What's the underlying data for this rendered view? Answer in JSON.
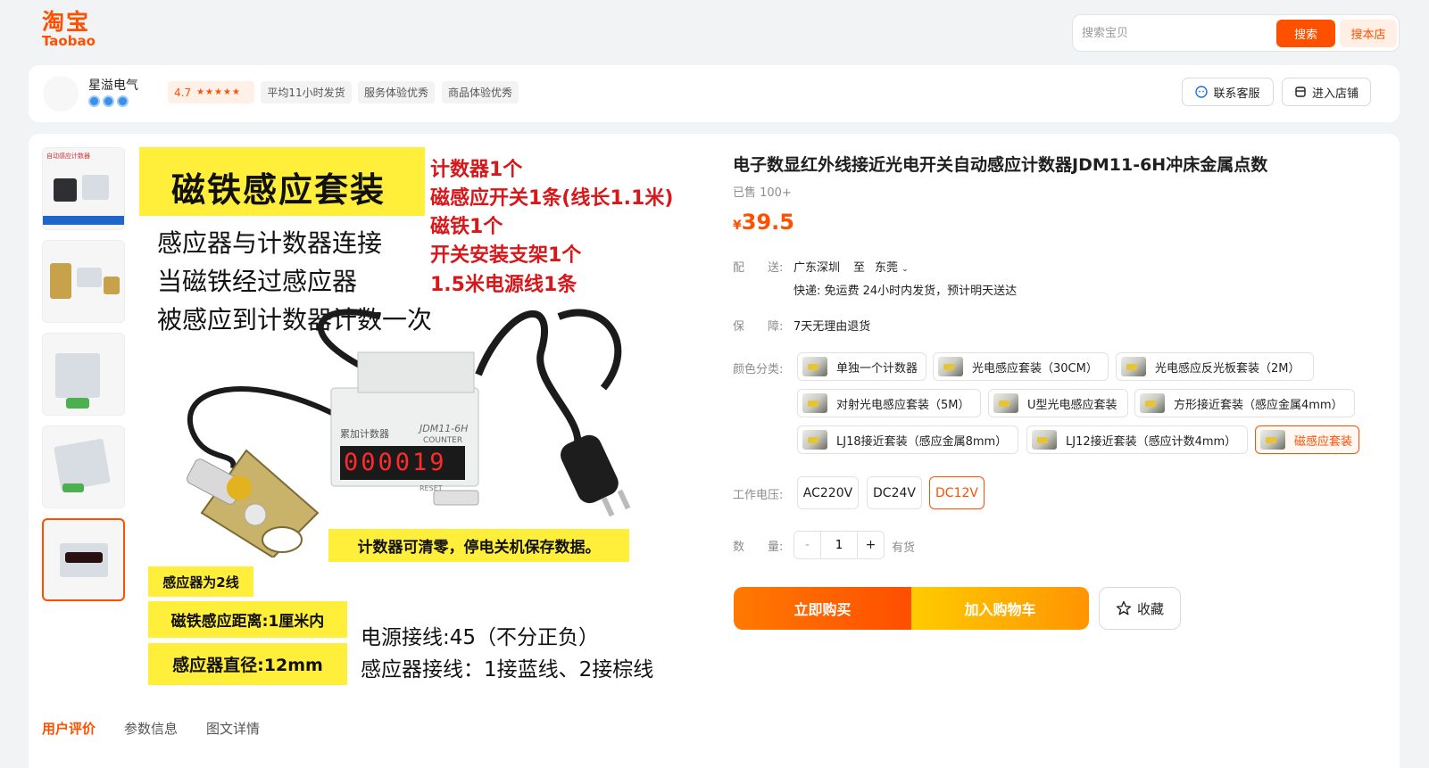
{
  "header": {
    "logo_cn": "淘宝",
    "logo_en": "Taobao",
    "search_placeholder": "搜索宝贝",
    "search_button": "搜索",
    "store_search_button": "搜本店"
  },
  "shop": {
    "name": "星溢电气",
    "rating": "4.7",
    "stars": "★★★★★",
    "tags": [
      "平均11小时发货",
      "服务体验优秀",
      "商品体验优秀"
    ],
    "contact_button": "联系客服",
    "enter_store_button": "进入店铺"
  },
  "gallery": {
    "image_text": {
      "title": "磁铁感应套装",
      "lines": [
        "感应器与计数器连接",
        "当磁铁经过感应器",
        "被感应到计数器计数一次"
      ],
      "contents": [
        "计数器1个",
        "磁感应开关1条(线长1.1米)",
        "磁铁1个",
        "开关安装支架1个",
        "1.5米电源线1条"
      ],
      "counter_label": "累加计数器",
      "counter_model": "JDM11-6H",
      "counter_sub": "COUNTER",
      "counter_display": "000019",
      "counter_reset": "RESET",
      "banner": "计数器可清零，停电关机保存数据。",
      "note1": "感应器为2线",
      "note2": "磁铁感应距离:1厘米内",
      "note3": "感应器直径:12mm",
      "wiring1": "电源接线:45（不分正负）",
      "wiring2": "感应器接线：1接蓝线、2接棕线"
    },
    "thumb1_title": "自动感应计数器"
  },
  "product": {
    "title": "电子数显红外线接近光电开关自动感应计数器JDM11-6H冲床金属点数",
    "sold": "已售 100+",
    "currency": "¥",
    "price": "39.5",
    "delivery_label": "配　　送:",
    "ship_from": "广东深圳",
    "ship_to_word": "至",
    "ship_to": "东莞",
    "delivery_detail": "快递: 免运费  24小时内发货，预计明天送达",
    "guarantee_label": "保　　障:",
    "guarantee": "7天无理由退货",
    "color_label": "颜色分类:",
    "colors": [
      "单独一个计数器",
      "光电感应套装（30CM）",
      "光电感应反光板套装（2M）",
      "对射光电感应套装（5M）",
      "U型光电感应套装",
      "方形接近套装（感应金属4mm）",
      "LJ18接近套装（感应金属8mm）",
      "LJ12接近套装（感应计数4mm）",
      "磁感应套装"
    ],
    "selected_color": "磁感应套装",
    "voltage_label": "工作电压:",
    "voltages": [
      "AC220V",
      "DC24V",
      "DC12V"
    ],
    "selected_voltage": "DC12V",
    "qty_label": "数　　量:",
    "qty": "1",
    "stock": "有货",
    "buy_button": "立即购买",
    "cart_button": "加入购物车",
    "fav_button": "收藏"
  },
  "tabs": [
    "用户评价",
    "参数信息",
    "图文详情"
  ],
  "colors": {
    "accent": "#ff5000",
    "cart": "#ffb300"
  }
}
